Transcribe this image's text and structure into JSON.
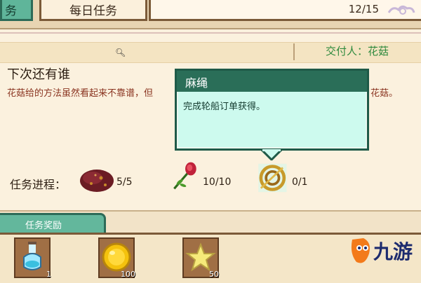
{
  "top": {
    "tab_main": "务",
    "tab_daily": "每日任务",
    "progress": "12/15"
  },
  "quest": {
    "giver": "交付人：花菇",
    "title": "下次还有谁",
    "desc_left": "花菇给的方法虽然看起来不靠谱，但",
    "desc_right": "花菇。"
  },
  "tooltip": {
    "title": "麻绳",
    "body": "完成轮船订单获得。"
  },
  "progress_row": {
    "label": "任务进程：",
    "items": [
      {
        "icon": "meat-icon",
        "count": "5/5"
      },
      {
        "icon": "rose-icon",
        "count": "10/10"
      },
      {
        "icon": "rope-icon",
        "count": "0/1"
      }
    ]
  },
  "rewards": {
    "tab_label": "任务奖励",
    "items": [
      {
        "icon": "potion-icon",
        "count": "1"
      },
      {
        "icon": "gold-coin-icon",
        "count": "100"
      },
      {
        "icon": "star-icon",
        "count": "50"
      }
    ]
  },
  "logo": {
    "text": "九游"
  },
  "colors": {
    "panel": "#fbf1de",
    "accent_green": "#2a6e58",
    "tooltip_bg": "#cdfaee",
    "desc_red": "#8a3420",
    "giver_green": "#2f8a3e"
  }
}
